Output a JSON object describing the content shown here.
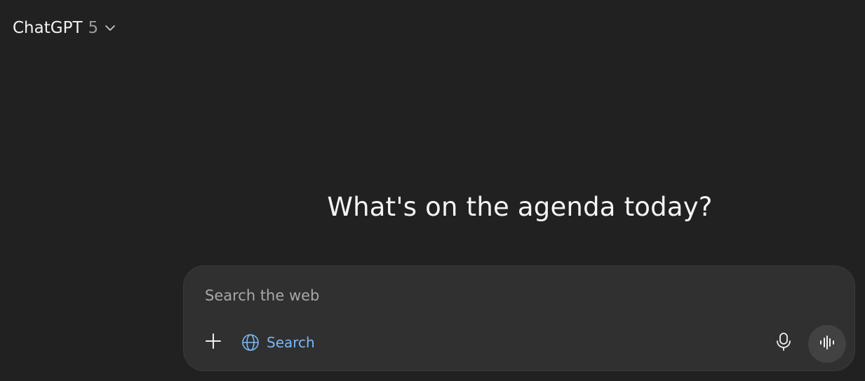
{
  "header": {
    "model_name": "ChatGPT",
    "model_version": "5",
    "dropdown_icon": "chevron-down-icon"
  },
  "main": {
    "headline": "What's on the agenda today?"
  },
  "composer": {
    "placeholder": "Search the web",
    "value": "",
    "add_icon": "plus-icon",
    "search_tool_label": "Search",
    "search_tool_icon": "globe-icon",
    "search_tool_color": "#7ab8f5",
    "mic_icon": "microphone-icon",
    "voice_icon": "voice-waveform-icon"
  },
  "colors": {
    "background": "#212121",
    "composer_background": "#303030",
    "voice_button_background": "#424242"
  }
}
